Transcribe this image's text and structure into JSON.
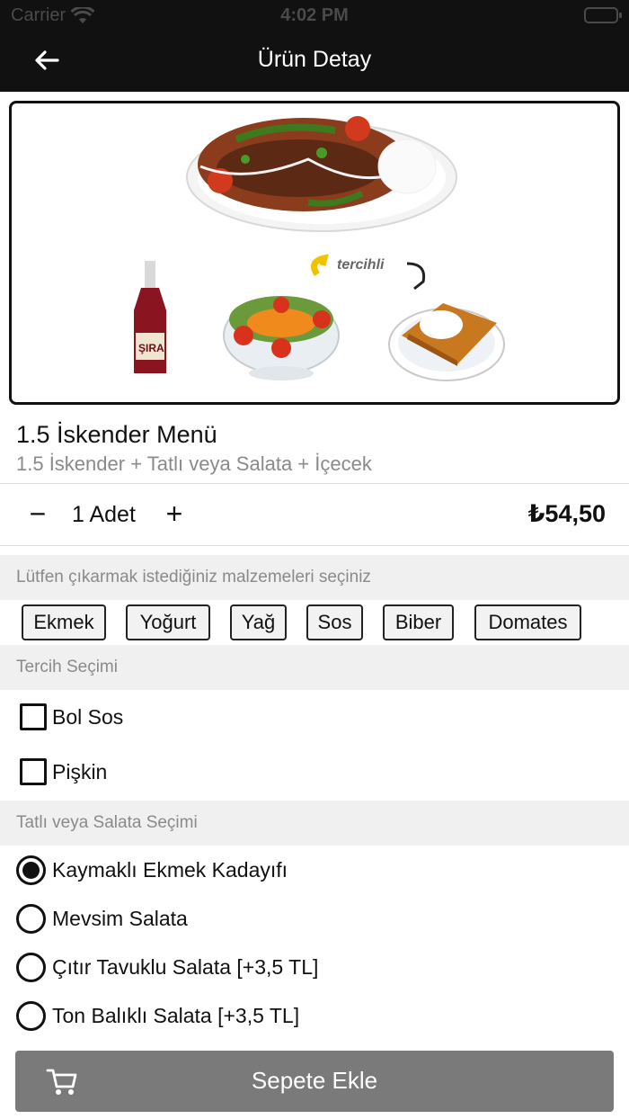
{
  "status_bar": {
    "carrier": "Carrier",
    "time": "4:02 PM"
  },
  "nav": {
    "title": "Ürün Detay",
    "back_icon": "arrow-left-icon"
  },
  "product": {
    "image_label": "tercihli",
    "name": "1.5 İskender Menü",
    "description": "1.5 İskender + Tatlı veya Salata + İçecek"
  },
  "quantity": {
    "minus": "−",
    "plus": "+",
    "text": "1 Adet",
    "price": "₺54,50"
  },
  "remove_ingredients": {
    "header": "Lütfen çıkarmak istediğiniz malzemeleri seçiniz",
    "chips": [
      "Ekmek",
      "Yoğurt",
      "Yağ",
      "Sos",
      "Biber",
      "Domates"
    ]
  },
  "preferences": {
    "header": "Tercih Seçimi",
    "options": [
      {
        "label": "Bol Sos",
        "checked": false
      },
      {
        "label": "Pişkin",
        "checked": false
      }
    ]
  },
  "dessert_salad": {
    "header": "Tatlı veya Salata Seçimi",
    "options": [
      {
        "label": "Kaymaklı Ekmek Kadayıfı",
        "selected": true
      },
      {
        "label": "Mevsim Salata",
        "selected": false
      },
      {
        "label": "Çıtır Tavuklu Salata [+3,5 TL]",
        "selected": false
      },
      {
        "label": "Ton Balıklı Salata [+3,5 TL]",
        "selected": false
      }
    ]
  },
  "cart_button": {
    "label": "Sepete Ekle",
    "icon": "cart-icon"
  },
  "colors": {
    "header_bg": "#111111",
    "section_bg": "#f0f0f0",
    "button_bg": "#7a7a7a"
  }
}
